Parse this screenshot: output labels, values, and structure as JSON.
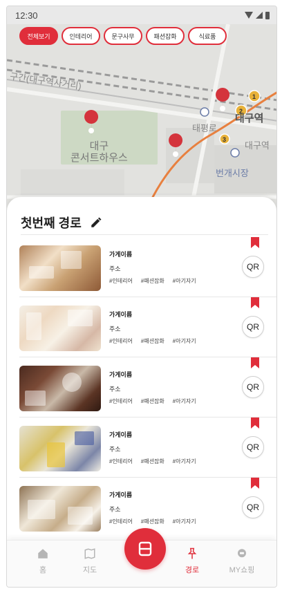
{
  "status_bar": {
    "time": "12:30"
  },
  "filters": [
    {
      "label": "전체보기",
      "active": true
    },
    {
      "label": "인테리어",
      "active": false
    },
    {
      "label": "문구사무",
      "active": false
    },
    {
      "label": "패션잡화",
      "active": false
    },
    {
      "label": "식료품",
      "active": false
    }
  ],
  "map": {
    "labels": {
      "concert_hall_line1": "대구",
      "concert_hall_line2": "콘서트하우스",
      "station": "대구역",
      "market": "번개시장",
      "road_1": "구간(대구역사거리)",
      "road_2": "태평로",
      "road_3": "대구역"
    },
    "markers": [
      "1",
      "2",
      "3"
    ]
  },
  "route": {
    "title": "첫번째 경로",
    "items": [
      {
        "name": "가게이름",
        "address": "주소",
        "tags": [
          "#인테리어",
          "#패션잡화",
          "#아기자기"
        ],
        "qr": "QR"
      },
      {
        "name": "가게이름",
        "address": "주소",
        "tags": [
          "#인테리어",
          "#패션잡화",
          "#아기자기"
        ],
        "qr": "QR"
      },
      {
        "name": "가게이름",
        "address": "주소",
        "tags": [
          "#인테리어",
          "#패션잡화",
          "#아기자기"
        ],
        "qr": "QR"
      },
      {
        "name": "가게이름",
        "address": "주소",
        "tags": [
          "#인테리어",
          "#패션잡화",
          "#아기자기"
        ],
        "qr": "QR"
      },
      {
        "name": "가게이름",
        "address": "주소",
        "tags": [
          "#인테리어",
          "#패션잡화",
          "#아기자기"
        ],
        "qr": "QR"
      }
    ]
  },
  "nav": {
    "home": "홈",
    "map": "지도",
    "route": "경로",
    "my": "MY쇼핑"
  },
  "colors": {
    "accent": "#e02e3b",
    "inactive": "#aaaaaa"
  }
}
